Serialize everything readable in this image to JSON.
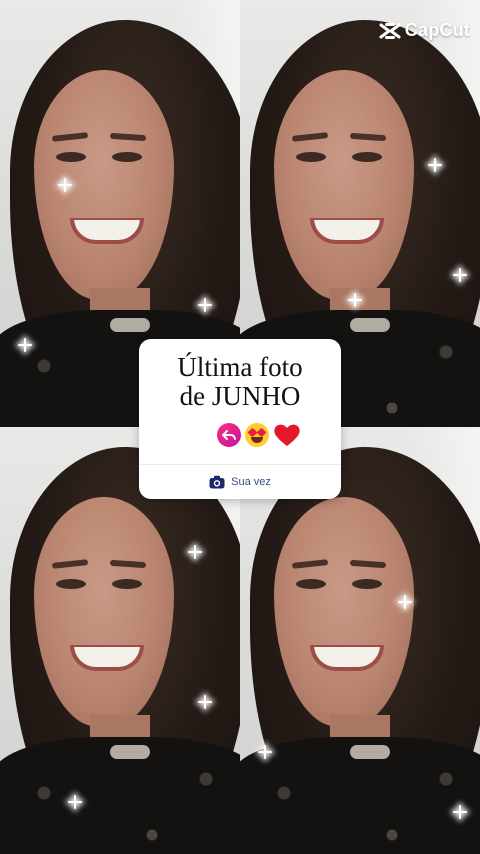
{
  "watermark": {
    "brand": "CapCut",
    "icon": "capcut-logo-icon"
  },
  "sticker": {
    "title_line1": "Última foto",
    "title_line2": "de JUNHO",
    "reactions": [
      "reply-arrow-icon",
      "heart-eyes-emoji-icon",
      "red-heart-icon"
    ],
    "reply_label": "Sua vez",
    "reply_icon": "camera-icon",
    "accent_color": "#e0237f"
  },
  "photo_grid": {
    "tiles": [
      {
        "name": "photo-top-left"
      },
      {
        "name": "photo-top-right"
      },
      {
        "name": "photo-bottom-left"
      },
      {
        "name": "photo-bottom-right"
      }
    ]
  }
}
